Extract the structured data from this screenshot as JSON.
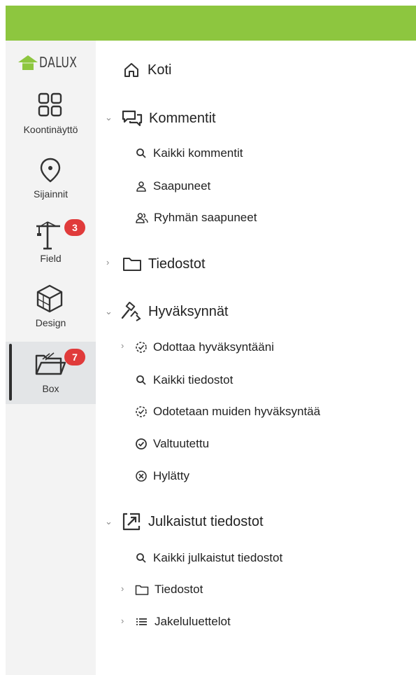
{
  "brand": {
    "name": "DALUX",
    "accent": "#8dc63f"
  },
  "rail": {
    "items": [
      {
        "label": "Koontinäyttö",
        "icon": "dashboard-icon"
      },
      {
        "label": "Sijainnit",
        "icon": "location-pin-icon"
      },
      {
        "label": "Field",
        "icon": "crane-icon",
        "badge": "3"
      },
      {
        "label": "Design",
        "icon": "cube-icon"
      },
      {
        "label": "Box",
        "icon": "folder-open-icon",
        "badge": "7",
        "active": true
      }
    ]
  },
  "nav": {
    "koti": "Koti",
    "kommentit": {
      "label": "Kommentit",
      "items": [
        "Kaikki kommentit",
        "Saapuneet",
        "Ryhmän saapuneet"
      ]
    },
    "tiedostot": "Tiedostot",
    "hyvaksynnat": {
      "label": "Hyväksynnät",
      "items": [
        "Odottaa hyväksyntääni",
        "Kaikki tiedostot",
        "Odotetaan muiden hyväksyntää",
        "Valtuutettu",
        "Hylätty"
      ]
    },
    "julkaistut": {
      "label": "Julkaistut tiedostot",
      "items": [
        "Kaikki julkaistut tiedostot",
        "Tiedostot",
        "Jakeluluettelot"
      ]
    }
  }
}
